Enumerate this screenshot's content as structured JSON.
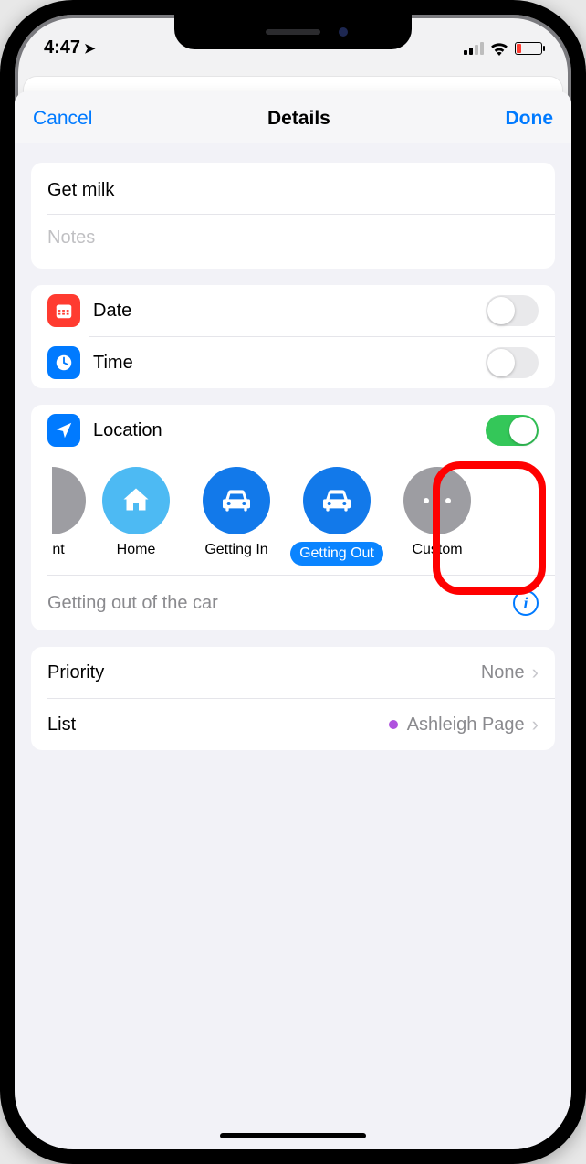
{
  "status": {
    "time": "4:47"
  },
  "nav": {
    "cancel": "Cancel",
    "title": "Details",
    "done": "Done"
  },
  "reminder": {
    "title": "Get milk",
    "notes_placeholder": "Notes"
  },
  "options": {
    "date_label": "Date",
    "time_label": "Time",
    "location_label": "Location"
  },
  "location_presets": {
    "item0": "nt",
    "item1": "Home",
    "item2": "Getting In",
    "item3": "Getting Out",
    "item4": "Custom",
    "detail": "Getting out of the car"
  },
  "priority": {
    "label": "Priority",
    "value": "None"
  },
  "list": {
    "label": "List",
    "value": "Ashleigh Page"
  }
}
